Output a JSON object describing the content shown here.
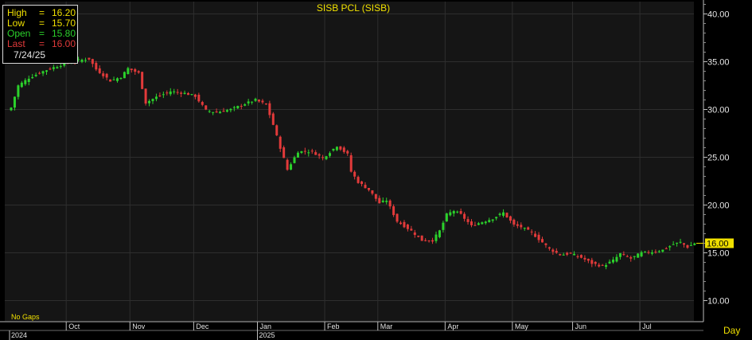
{
  "colors": {
    "background": "#000000",
    "plot_background": "#151515",
    "grid": "#2e2e2e",
    "up_candle": "#2bd12b",
    "down_candle": "#e23a3a",
    "text": "#e6e6e6",
    "title": "#f0e000",
    "price_tag": "#f0e000"
  },
  "ohlc_box": {
    "high_label": "High",
    "high_value": "16.20",
    "low_label": "Low",
    "low_value": "15.70",
    "open_label": "Open",
    "open_value": "15.80",
    "last_label": "Last",
    "last_value": "16.00",
    "eq": "=",
    "date": "7/24/25"
  },
  "footer": {
    "gaps_label": "No Gaps",
    "period_label": "Day"
  },
  "chart_data": {
    "type": "candlestick",
    "title": "SISB  PCL  (SISB)",
    "ylim": [
      7.5,
      42
    ],
    "y_ticks": [
      "10.00",
      "15.00",
      "20.00",
      "25.00",
      "30.00",
      "35.00",
      "40.00"
    ],
    "y_tick_values": [
      10,
      15,
      20,
      25,
      30,
      35,
      40
    ],
    "last_price_label": "16.00",
    "last_price": 16.0,
    "month_labels": [
      "Oct",
      "Nov",
      "Dec",
      "Jan",
      "Feb",
      "Mar",
      "Apr",
      "May",
      "Jun",
      "Jul"
    ],
    "month_start_index": [
      16,
      34,
      52,
      70,
      89,
      104,
      123,
      142,
      159,
      178
    ],
    "year_labels": [
      "2024",
      "2025"
    ],
    "year_start_index": [
      0,
      70
    ],
    "grid": true,
    "price_trend": {
      "index": [
        0,
        2,
        5,
        9,
        12,
        16,
        18,
        22,
        24,
        28,
        31,
        33,
        36,
        38,
        41,
        45,
        49,
        52,
        55,
        58,
        62,
        66,
        69,
        72,
        74,
        76,
        78,
        81,
        85,
        88,
        92,
        95,
        96,
        98,
        101,
        104,
        106,
        109,
        113,
        116,
        119,
        121,
        123,
        125,
        127,
        130,
        132,
        136,
        139,
        142,
        144,
        147,
        150,
        152,
        155,
        158,
        161,
        164,
        167,
        170,
        172,
        175,
        178,
        181,
        184,
        187,
        189,
        191,
        193
      ],
      "close": [
        30.2,
        32.5,
        33.3,
        34.0,
        34.4,
        34.9,
        35.1,
        35.3,
        34.2,
        33.0,
        33.4,
        34.3,
        33.8,
        30.7,
        31.3,
        31.9,
        31.7,
        31.4,
        29.9,
        29.7,
        30.0,
        30.6,
        31.0,
        30.5,
        28.4,
        26.0,
        23.7,
        25.6,
        25.6,
        24.9,
        26.2,
        25.3,
        23.5,
        22.4,
        21.6,
        20.2,
        20.5,
        18.3,
        17.3,
        16.3,
        16.3,
        17.3,
        19.0,
        19.4,
        19.0,
        17.8,
        18.1,
        18.6,
        19.2,
        17.9,
        17.7,
        17.1,
        16.1,
        15.4,
        14.8,
        14.9,
        14.5,
        13.9,
        13.6,
        14.2,
        14.9,
        14.4,
        15.0,
        15.1,
        15.3,
        15.9,
        16.1,
        15.6,
        16.0
      ]
    }
  }
}
